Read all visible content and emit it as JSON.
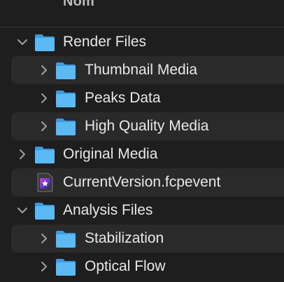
{
  "header": {
    "name_column_label": "Nom"
  },
  "rows": [
    {
      "label": "Render Files",
      "kind": "folder",
      "expanded": true
    },
    {
      "label": "Thumbnail Media",
      "kind": "folder",
      "expanded": false
    },
    {
      "label": "Peaks Data",
      "kind": "folder",
      "expanded": false
    },
    {
      "label": "High Quality Media",
      "kind": "folder",
      "expanded": false
    },
    {
      "label": "Original Media",
      "kind": "folder",
      "expanded": false
    },
    {
      "label": "CurrentVersion.fcpevent",
      "kind": "file"
    },
    {
      "label": "Analysis Files",
      "kind": "folder",
      "expanded": true
    },
    {
      "label": "Stabilization",
      "kind": "folder",
      "expanded": false
    },
    {
      "label": "Optical Flow",
      "kind": "folder",
      "expanded": false
    }
  ],
  "colors": {
    "background": "#1e1e1e",
    "alt_row": "#2a2a2a",
    "folder_blue": "#4fb3f0",
    "text": "#e8e8e8"
  },
  "icons": {
    "folder": "folder-icon",
    "file": "fcpevent-file-icon",
    "expanded": "chevron-down-icon",
    "collapsed": "chevron-right-icon"
  }
}
